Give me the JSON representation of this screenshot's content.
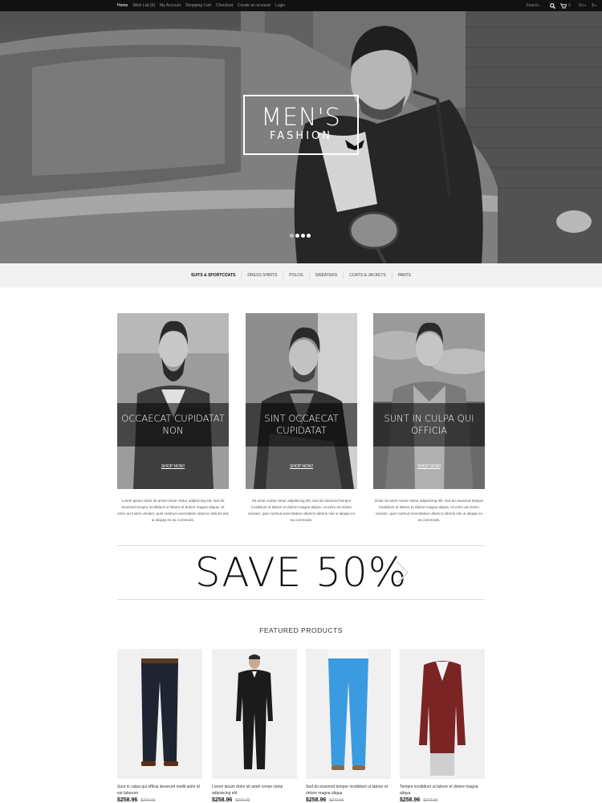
{
  "topbar": {
    "nav": [
      "Home",
      "Wish List (0)",
      "My Account",
      "Shopping Cart",
      "Checkout",
      "Create an account",
      "Login"
    ],
    "search_placeholder": "Search...",
    "cart_count": "0",
    "language": "En",
    "currency": "$"
  },
  "hero": {
    "title": "MEN'S",
    "subtitle": "FASHION",
    "slides": 4,
    "active_slide": 2
  },
  "categories": [
    "SUITS & SPORTCOATS",
    "DRESS SHIRTS",
    "POLOS",
    "SWEATERS",
    "COATS & JACKETS",
    "PANTS"
  ],
  "banners": [
    {
      "caption": "OCCAECAT CUPIDATAT NON",
      "cta": "SHOP NOW!",
      "desc": "Lorem ipsum dolor sit amet conse ctetur adipisicing elit, sed do eiusmod tempor incididunt ut labore et dolore magna aliqua. Ut enim ad minim veniam, quis nostrud exercitation ullamco laboris nisi ut aliquip ex ea commodo."
    },
    {
      "caption": "SINT OCCAECAT CUPIDATAT",
      "cta": "SHOP NOW!",
      "desc": "Sit amet conse ctetur adipisicing elit, sed do eiusmod tempor incididunt ut labore et dolore magna aliqua. Ut enim ad minim veniam, quis nostrud exercitation ullamco laboris nisi ut aliquip ex ea commodo."
    },
    {
      "caption": "SUNT IN CULPA QUI OFFICIA",
      "cta": "SHOP NOW!",
      "desc": "Dolor sit amet conse ctetur adipisicing elit, sed do eiusmod tempor incididunt ut labore et dolore magna aliqua. Ut enim ad minim veniam, quis nostrud exercitation ullamco laboris nisi ut aliquip ex ea commodo."
    }
  ],
  "promo": {
    "text": "SAVE 50%"
  },
  "featured": {
    "title": "FEATURED PRODUCTS",
    "products": [
      {
        "name": "Sunt in culpa qui officia deserunt mollit anim id est laborum",
        "price": "$258.96",
        "old_price": "$272.90"
      },
      {
        "name": "Lorem ipsum dolor sit amet conse ctetur adipisicing elit",
        "price": "$258.96",
        "old_price": "$272.90"
      },
      {
        "name": "Sed do eiusmod tempor incididunt ut labore et dolore magna aliqua",
        "price": "$258.96",
        "old_price": "$272.90"
      },
      {
        "name": "Tempor incididunt ut labore et dolore magna aliqua",
        "price": "$258.96",
        "old_price": "$272.90"
      }
    ]
  },
  "colors": {
    "topbar": "#111111",
    "catbar": "#f2f2f2",
    "pants_blue": "#3b9be0",
    "sweater_red": "#7a2424"
  },
  "icons": [
    "search-icon",
    "cart-icon",
    "chevron-right-icon"
  ]
}
